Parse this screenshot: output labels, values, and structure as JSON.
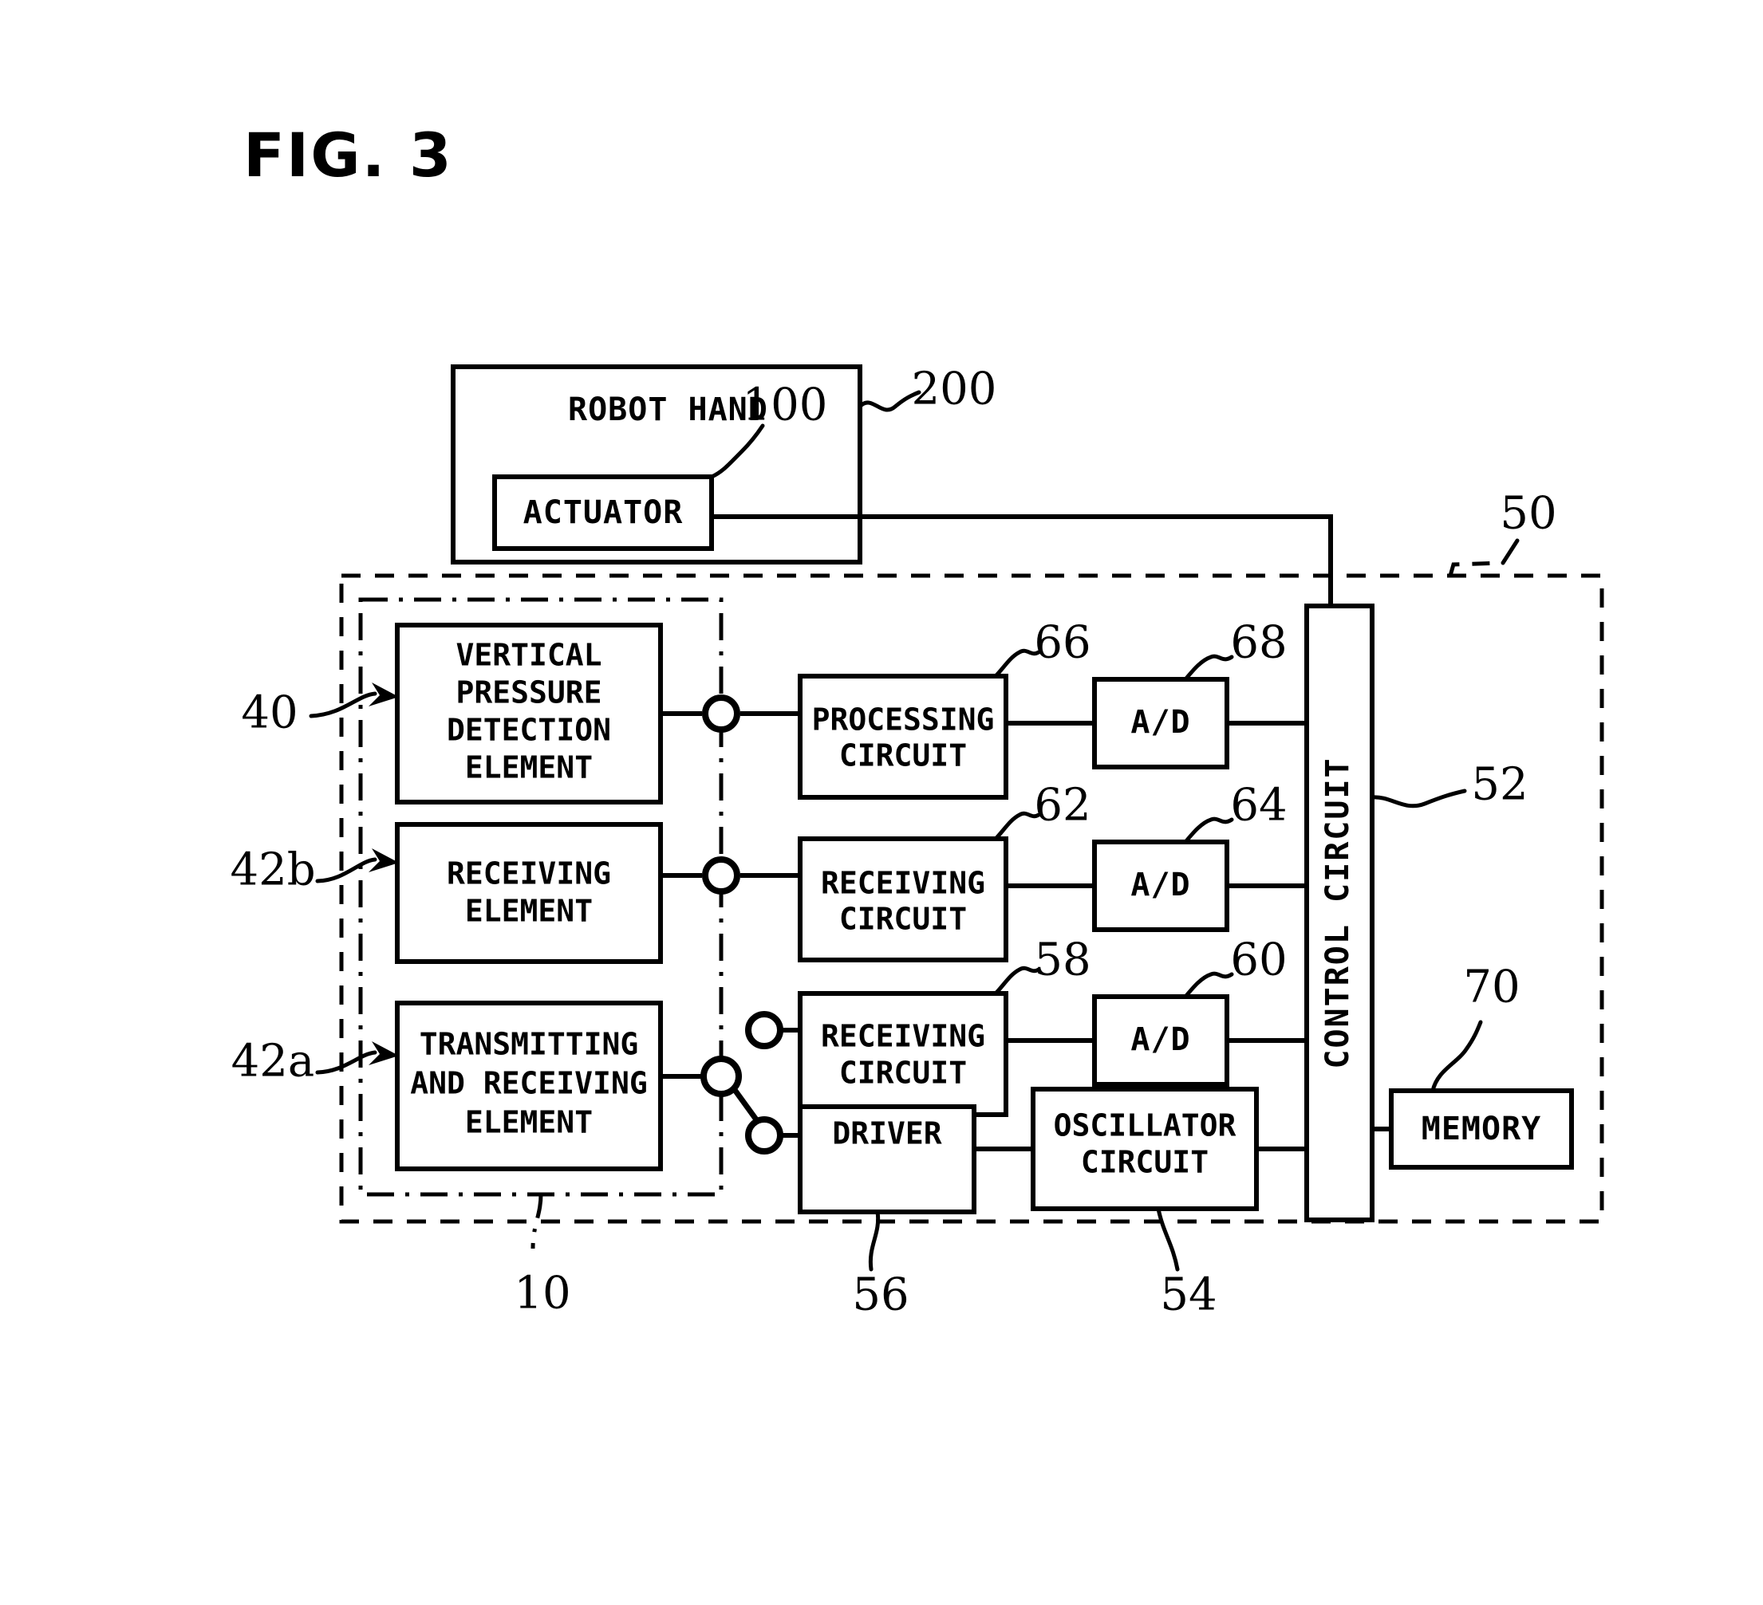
{
  "figure": {
    "title": "FIG. 3",
    "type": "patent-block-diagram"
  },
  "blocks": {
    "robot_hand": {
      "label": "ROBOT HAND",
      "ref": "200"
    },
    "actuator": {
      "label": "ACTUATOR",
      "ref": "100"
    },
    "vertical_pressure_detection_element": {
      "line1": "VERTICAL",
      "line2": "PRESSURE",
      "line3": "DETECTION",
      "line4": "ELEMENT",
      "ref": "40"
    },
    "receiving_element": {
      "line1": "RECEIVING",
      "line2": "ELEMENT",
      "ref": "42b"
    },
    "transmitting_and_receiving_element": {
      "line1": "TRANSMITTING",
      "line2": "AND RECEIVING",
      "line3": "ELEMENT",
      "ref": "42a"
    },
    "processing_circuit": {
      "line1": "PROCESSING",
      "line2": "CIRCUIT",
      "ref": "66"
    },
    "receiving_circuit_62": {
      "line1": "RECEIVING",
      "line2": "CIRCUIT",
      "ref": "62"
    },
    "receiving_circuit_58": {
      "line1": "RECEIVING",
      "line2": "CIRCUIT",
      "ref": "58"
    },
    "ad_68": {
      "label": "A/D",
      "ref": "68"
    },
    "ad_64": {
      "label": "A/D",
      "ref": "64"
    },
    "ad_60": {
      "label": "A/D",
      "ref": "60"
    },
    "driver": {
      "label": "DRIVER",
      "ref": "56"
    },
    "oscillator_circuit": {
      "line1": "OSCILLATOR",
      "line2": "CIRCUIT",
      "ref": "54"
    },
    "control_circuit": {
      "label": "CONTROL CIRCUIT",
      "ref": "52"
    },
    "memory": {
      "label": "MEMORY",
      "ref": "70"
    }
  },
  "enclosures": {
    "outer_dashed": {
      "ref": "50"
    },
    "inner_dashdot": {
      "ref": "10"
    }
  },
  "reference_numerals": {
    "n200": "200",
    "n100": "100",
    "n50": "50",
    "n52": "52",
    "n40": "40",
    "n42b": "42b",
    "n42a": "42a",
    "n66": "66",
    "n68": "68",
    "n62": "62",
    "n64": "64",
    "n58": "58",
    "n60": "60",
    "n70": "70",
    "n10": "10",
    "n56": "56",
    "n54": "54"
  },
  "colors": {
    "ink": "#000000",
    "paper": "#ffffff"
  }
}
